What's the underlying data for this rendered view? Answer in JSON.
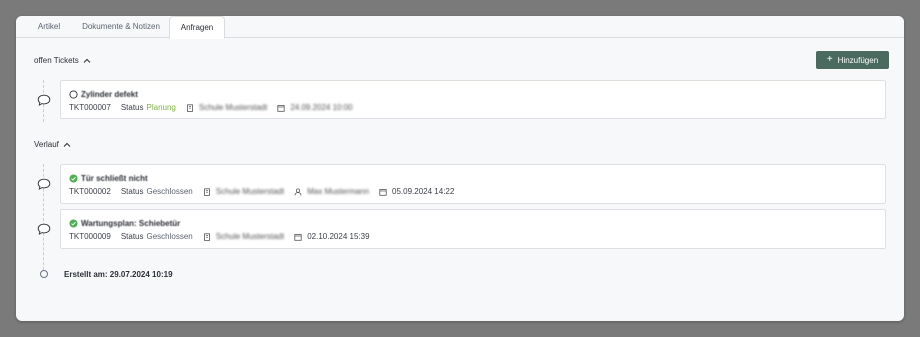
{
  "tabs": [
    {
      "label": "Artikel",
      "active": false
    },
    {
      "label": "Dokumente & Notizen",
      "active": false
    },
    {
      "label": "Anfragen",
      "active": true
    }
  ],
  "open_section": {
    "title": "offen Tickets",
    "chevron": "chevron-up-icon"
  },
  "add_button": {
    "label": "Hinzufügen",
    "icon": "plus-icon"
  },
  "open_tickets": [
    {
      "title": "Zylinder defekt",
      "status_icon": "circle-outline-icon",
      "id": "TKT000007",
      "status_label": "Status",
      "status_value": "Planung",
      "building": "Schule Musterstadt",
      "date": "24.09.2024 10:00"
    }
  ],
  "history_section": {
    "title": "Verlauf",
    "chevron": "chevron-up-icon"
  },
  "history_tickets": [
    {
      "title": "Tür schließt nicht",
      "status_icon": "check-circle-icon",
      "id": "TKT000002",
      "status_label": "Status",
      "status_value": "Geschlossen",
      "building": "Schule Musterstadt",
      "person": "Max Mustermann",
      "date": "05.09.2024 14:22"
    },
    {
      "title": "Wartungsplan: Schiebetür",
      "status_icon": "check-circle-icon",
      "id": "TKT000009",
      "status_label": "Status",
      "status_value": "Geschlossen",
      "building": "Schule Musterstadt",
      "date": "02.10.2024 15:39"
    }
  ],
  "created": "Erstellt am: 29.07.2024 10:19",
  "colors": {
    "accent": "#4a6a5f",
    "success": "#4caf50",
    "planung": "#7cb342"
  }
}
